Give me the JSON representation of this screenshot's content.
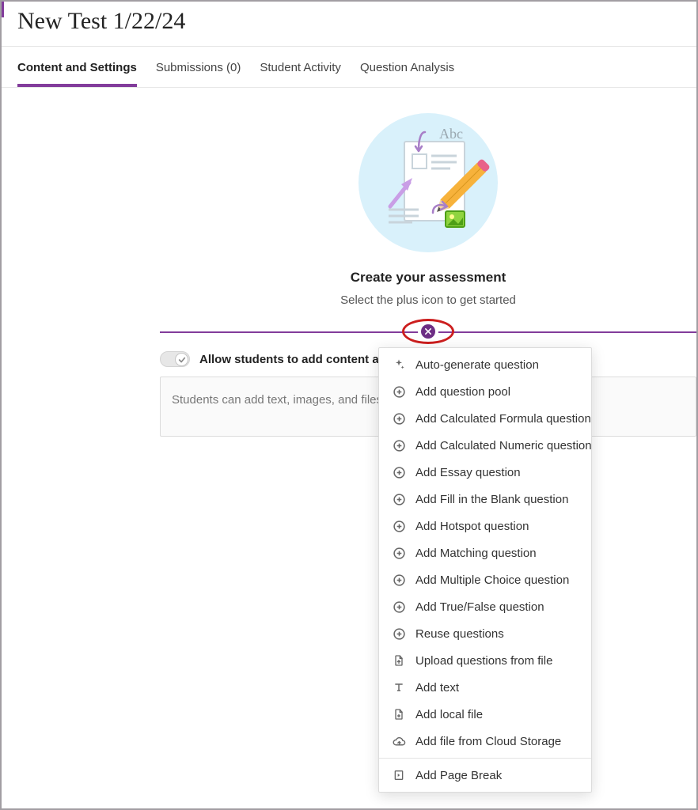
{
  "breadcrumb_stub": "",
  "page_title": "New Test 1/22/24",
  "tabs": [
    {
      "label": "Content and Settings",
      "active": true
    },
    {
      "label": "Submissions (0)",
      "active": false
    },
    {
      "label": "Student Activity",
      "active": false
    },
    {
      "label": "Question Analysis",
      "active": false
    }
  ],
  "empty_state": {
    "heading": "Create your assessment",
    "subtext": "Select the plus icon to get started"
  },
  "toggle": {
    "label": "Allow students to add content at end of assessment",
    "on": false
  },
  "student_box_placeholder": "Students can add text, images, and files here after selecting the plus icon.",
  "add_menu": {
    "items": [
      {
        "icon": "sparkle",
        "label": "Auto-generate question"
      },
      {
        "icon": "plus-circle",
        "label": "Add question pool"
      },
      {
        "icon": "plus-circle",
        "label": "Add Calculated Formula question"
      },
      {
        "icon": "plus-circle",
        "label": "Add Calculated Numeric question"
      },
      {
        "icon": "plus-circle",
        "label": "Add Essay question"
      },
      {
        "icon": "plus-circle",
        "label": "Add Fill in the Blank question"
      },
      {
        "icon": "plus-circle",
        "label": "Add Hotspot question"
      },
      {
        "icon": "plus-circle",
        "label": "Add Matching question"
      },
      {
        "icon": "plus-circle",
        "label": "Add Multiple Choice question"
      },
      {
        "icon": "plus-circle",
        "label": "Add True/False question"
      },
      {
        "icon": "plus-circle",
        "label": "Reuse questions"
      },
      {
        "icon": "file-up",
        "label": "Upload questions from file"
      },
      {
        "icon": "text",
        "label": "Add text"
      },
      {
        "icon": "file-plus",
        "label": "Add local file"
      },
      {
        "icon": "cloud",
        "label": "Add file from Cloud Storage"
      }
    ],
    "footer": {
      "icon": "page-break",
      "label": "Add Page Break"
    }
  },
  "icons": {
    "sparkle": "sparkle-icon",
    "plus-circle": "plus-circle-icon",
    "file-up": "file-upload-icon",
    "text": "text-icon",
    "file-plus": "file-plus-icon",
    "cloud": "cloud-icon",
    "page-break": "page-break-icon"
  }
}
